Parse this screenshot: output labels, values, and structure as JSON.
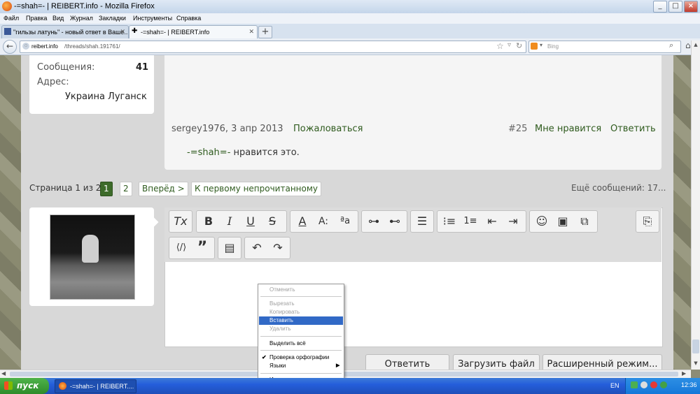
{
  "window": {
    "title": "-=shah=- | REIBERT.info - Mozilla Firefox"
  },
  "menu": [
    "Файл",
    "Правка",
    "Вид",
    "Журнал",
    "Закладки",
    "Инструменты",
    "Справка"
  ],
  "tabs": [
    {
      "label": "\"гильзы латунь\" - новый ответ в Ваше..."
    },
    {
      "label": "-=shah=- | REIBERT.info"
    }
  ],
  "nav": {
    "url_host": "reibert.info",
    "url_path": "/threads/shah.191761/",
    "search_placeholder": "Bing"
  },
  "userinfo": {
    "messages_label": "Сообщения:",
    "messages_count": "41",
    "address_label": "Адрес:",
    "address_value": "Украина Луганск"
  },
  "post": {
    "author_date": "sergey1976, 3 апр 2013",
    "report": "Пожаловаться",
    "number": "#25",
    "like": "Мне нравится",
    "reply": "Ответить",
    "liked_by": "-=shah=-",
    "liked_text": " нравится это."
  },
  "pagination": {
    "label": "Страница 1 из 2",
    "pages": [
      "1",
      "2"
    ],
    "next": "Вперёд >",
    "first_unread": "К первому непрочитанному",
    "more": "Ещё сообщений: 17..."
  },
  "actions": {
    "reply": "Ответить",
    "upload": "Загрузить файл",
    "advanced": "Расширенный режим..."
  },
  "context_menu": {
    "undo": "Отменить",
    "cut": "Вырезать",
    "copy": "Копировать",
    "paste": "Вставить",
    "delete": "Удалить",
    "select_all": "Выделить всё",
    "spellcheck": "Проверка орфографии",
    "languages": "Языки",
    "inspect": "Исследовать элемент"
  },
  "taskbar": {
    "start": "пуск",
    "task": "-=shah=- | REIBERT....",
    "lang": "EN",
    "time": "12:36"
  }
}
